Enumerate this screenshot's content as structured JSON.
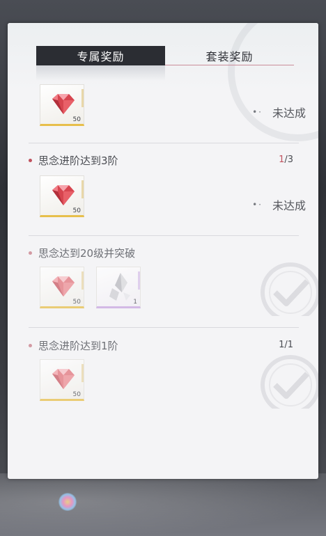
{
  "tabs": [
    {
      "label": "专属奖励",
      "active": true
    },
    {
      "label": "套装奖励",
      "active": false
    }
  ],
  "first_reward": {
    "qty": "50",
    "status": "未达成"
  },
  "tasks": [
    {
      "title": "思念进阶达到3阶",
      "progress_current": "1",
      "progress_total": "/3",
      "rewards": [
        {
          "qty": "50",
          "type": "gem"
        }
      ],
      "status": "未达成",
      "completed": false
    },
    {
      "title": "思念达到20级并突破",
      "progress_current": "",
      "progress_total": "",
      "rewards": [
        {
          "qty": "50",
          "type": "gem"
        },
        {
          "qty": "1",
          "type": "crystal"
        }
      ],
      "status": "",
      "completed": true
    },
    {
      "title": "思念进阶达到1阶",
      "progress_current": "1",
      "progress_total": "/1",
      "rewards": [
        {
          "qty": "50",
          "type": "gem"
        }
      ],
      "status": "",
      "completed": true
    }
  ],
  "colors": {
    "accent": "#c0525e",
    "tab_active_bg": "#2b2d33",
    "gold_rarity": "#e7bf4b",
    "purple_rarity": "#c9a6e0"
  },
  "icons": [
    "red-gem-icon",
    "crystal-shard-icon",
    "completed-check-icon"
  ]
}
